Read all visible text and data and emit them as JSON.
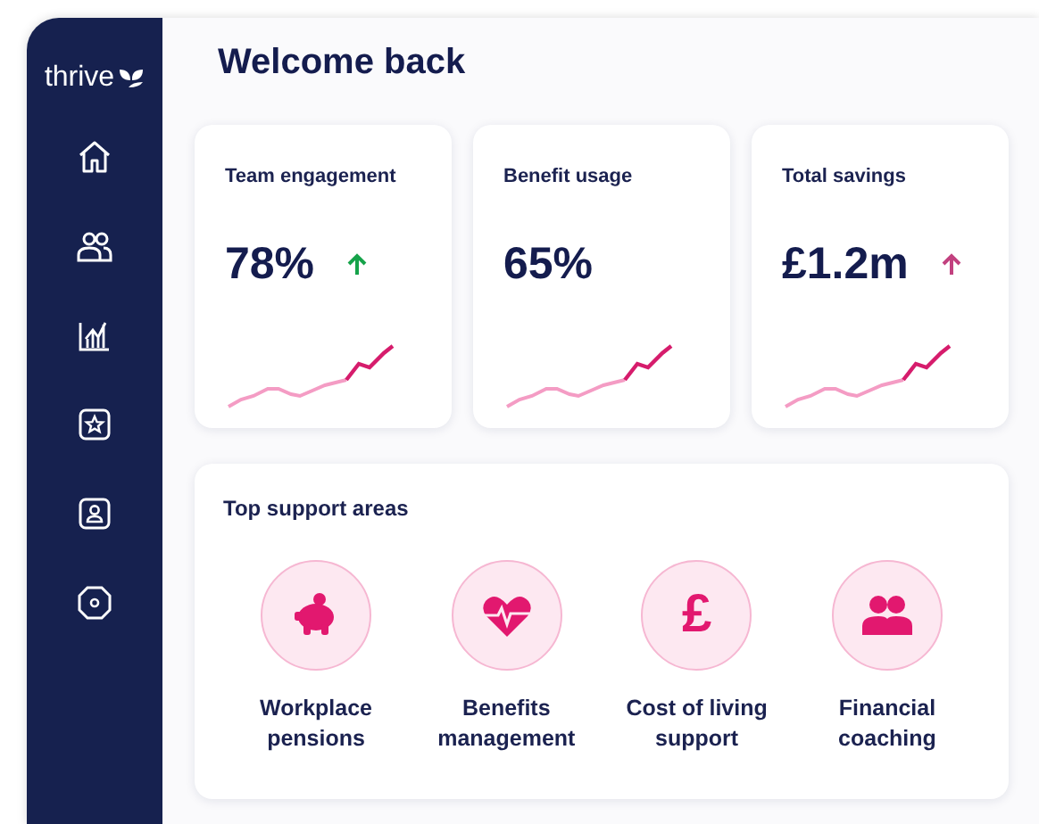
{
  "sidebar": {
    "logo": "thrive",
    "items": [
      {
        "kind": "home"
      },
      {
        "kind": "people"
      },
      {
        "kind": "chart"
      },
      {
        "kind": "star"
      },
      {
        "kind": "contact"
      },
      {
        "kind": "settings"
      }
    ]
  },
  "title": "Welcome back",
  "stats": [
    {
      "label": "Team engagement",
      "value": "78%",
      "trend_up": true,
      "color": "#16a34a"
    },
    {
      "label": "Benefit usage",
      "value": "65%",
      "trend_up": false
    },
    {
      "label": "Total savings",
      "value": "£1.2m",
      "trend_up": true,
      "color": "#c2417f"
    }
  ],
  "support": {
    "title": "Top support areas",
    "items": [
      {
        "kind": "piggy",
        "label": "Workplace pensions"
      },
      {
        "kind": "heart",
        "label": "Benefits management"
      },
      {
        "kind": "symbol",
        "symbol": "£",
        "label": "Cost of living support"
      },
      {
        "kind": "people",
        "label": "Financial coaching"
      }
    ]
  }
}
